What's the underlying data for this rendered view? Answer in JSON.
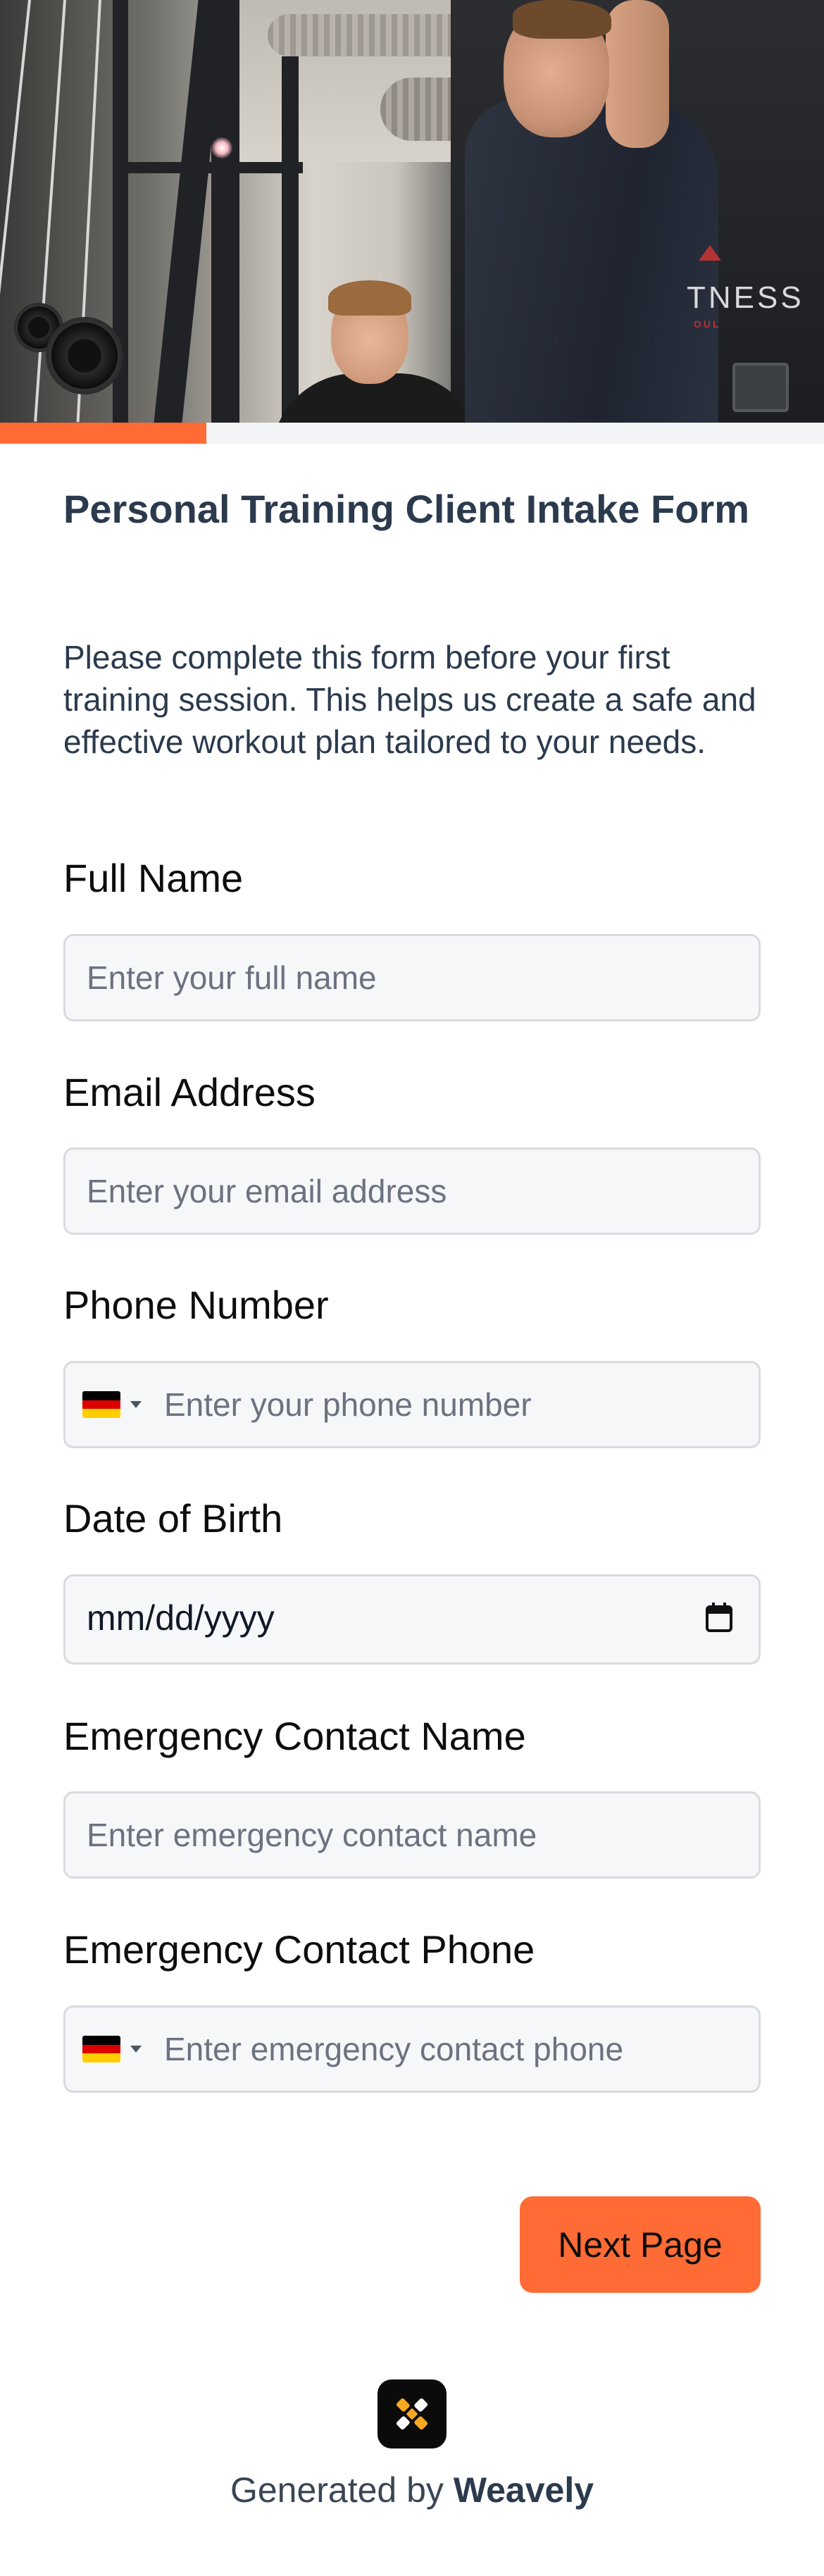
{
  "hero": {
    "image_name": "gym-trainer-photo",
    "logo_text": "TNESS",
    "logo_subtext": "OUL"
  },
  "progress": {
    "fraction": 0.25,
    "color": "#ff6b35"
  },
  "form": {
    "title": "Personal Training Client Intake Form",
    "description": "Please complete this form before your first training session. This helps us create a safe and effective workout plan tailored to your needs.",
    "fields": {
      "full_name": {
        "label": "Full Name",
        "placeholder": "Enter your full name"
      },
      "email": {
        "label": "Email Address",
        "placeholder": "Enter your email address"
      },
      "phone": {
        "label": "Phone Number",
        "placeholder": "Enter your phone number",
        "country_flag": "germany-flag-icon"
      },
      "dob": {
        "label": "Date of Birth",
        "placeholder": "mm/dd/yyyy",
        "icon": "calendar-icon"
      },
      "emergency_name": {
        "label": "Emergency Contact Name",
        "placeholder": "Enter emergency contact name"
      },
      "emergency_phone": {
        "label": "Emergency Contact Phone",
        "placeholder": "Enter emergency contact phone",
        "country_flag": "germany-flag-icon"
      }
    },
    "next_button": "Next Page"
  },
  "footer": {
    "prefix": "Generated by ",
    "brand": "Weavely",
    "logo_icon": "weavely-logo-icon"
  },
  "colors": {
    "accent": "#ff6b35",
    "title": "#2b3a4d",
    "field_bg": "#f6f7f9",
    "field_border": "#d8dbe0"
  }
}
